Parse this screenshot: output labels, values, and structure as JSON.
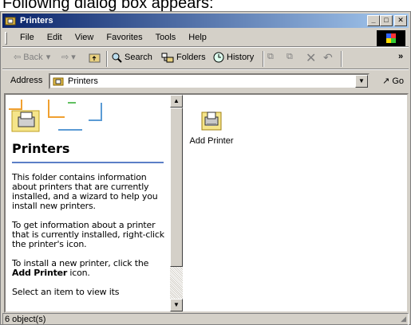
{
  "caption": "Following dialog box appears:",
  "window": {
    "title": "Printers",
    "buttons": {
      "minimize": "_",
      "maximize": "□",
      "close": "✕"
    }
  },
  "menu": [
    "File",
    "Edit",
    "View",
    "Favorites",
    "Tools",
    "Help"
  ],
  "toolbar": {
    "back": "Back",
    "search": "Search",
    "folders": "Folders",
    "history": "History",
    "overflow": "»"
  },
  "address": {
    "label": "Address",
    "value": "Printers",
    "go": "Go"
  },
  "left_panel": {
    "heading": "Printers",
    "p1": "This folder contains information about printers that are currently installed, and a wizard to help you install new printers.",
    "p2": "To get information about a printer that is currently installed, right-click the printer's icon.",
    "p3_prefix": "To install a new printer, click the",
    "p3_bold": "Add Printer",
    "p3_suffix": "icon.",
    "p4": "Select an item to view its"
  },
  "items": [
    {
      "label": "Add Printer",
      "icon": "add-printer-icon"
    }
  ],
  "status": {
    "text": "6 object(s)"
  }
}
